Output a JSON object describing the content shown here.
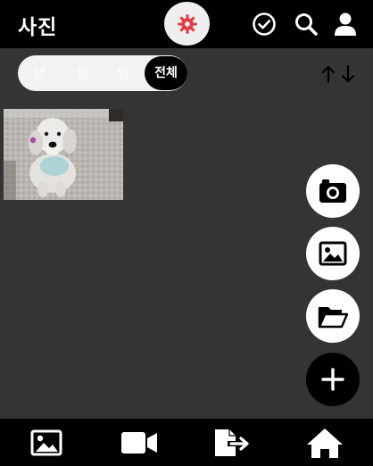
{
  "header": {
    "title": "사진",
    "icons": [
      "gear-icon",
      "check-circle-icon",
      "search-icon",
      "user-icon"
    ],
    "accent_color": "#e53945"
  },
  "filter": {
    "options": [
      "년",
      "월",
      "일",
      "전체"
    ],
    "selected": "전체",
    "sort_icon": "sort-up-down-icon"
  },
  "photos": [
    {
      "name": "photo-dog",
      "description_icon": "photo-thumbnail"
    }
  ],
  "fab": {
    "items": [
      "camera-icon",
      "image-icon",
      "folder-open-icon",
      "plus-icon"
    ]
  },
  "bottom_nav": {
    "items": [
      "image-icon",
      "video-icon",
      "export-icon",
      "home-icon"
    ]
  }
}
